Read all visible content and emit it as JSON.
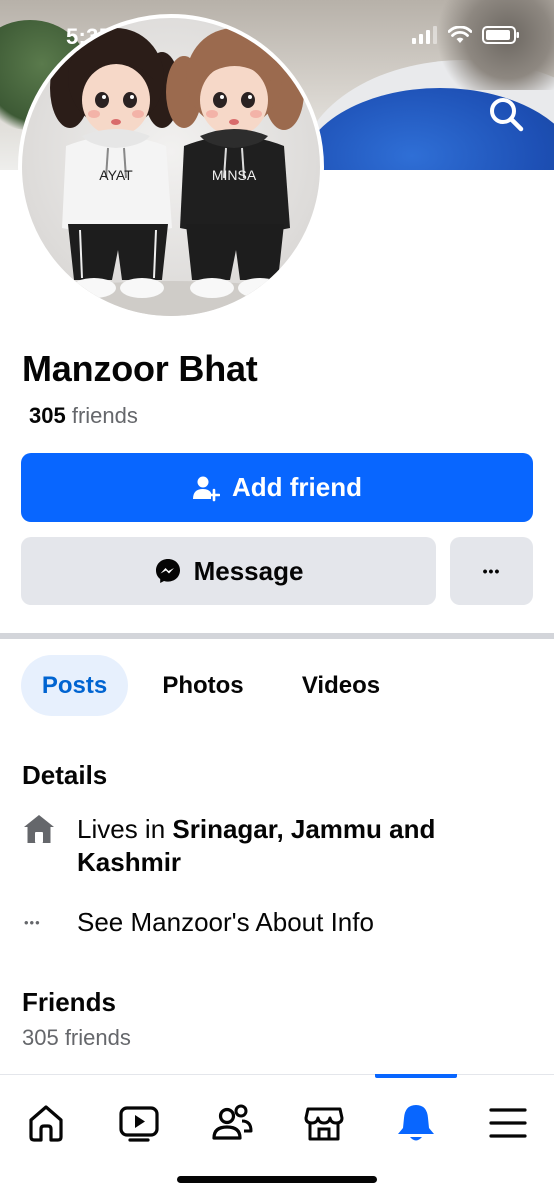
{
  "status_bar": {
    "time": "5:35"
  },
  "header": {
    "back_icon": "chevron-left-icon",
    "search_icon": "search-icon"
  },
  "avatar": {
    "left_hoodie_text": "AYAT",
    "right_hoodie_text": "MINSA"
  },
  "profile": {
    "name": "Manzoor Bhat",
    "friends_count": "305",
    "friends_word": "friends"
  },
  "actions": {
    "add_friend_label": "Add friend",
    "message_label": "Message",
    "more_label": "•••"
  },
  "tabs": [
    {
      "label": "Posts",
      "active": true
    },
    {
      "label": "Photos",
      "active": false
    },
    {
      "label": "Videos",
      "active": false
    }
  ],
  "details": {
    "title": "Details",
    "lives_prefix": "Lives in ",
    "lives_place": "Srinagar, Jammu and Kashmir",
    "about_dots": "•••",
    "about_label": "See Manzoor's About Info"
  },
  "friends_section": {
    "title": "Friends",
    "count_text": "305 friends"
  },
  "bottom_nav": {
    "items": [
      {
        "icon": "home-icon"
      },
      {
        "icon": "video-icon"
      },
      {
        "icon": "friends-icon"
      },
      {
        "icon": "marketplace-icon"
      },
      {
        "icon": "bell-icon",
        "active": true
      },
      {
        "icon": "menu-icon"
      }
    ]
  },
  "colors": {
    "accent": "#0866ff",
    "tab_active_bg": "#e7f0fd",
    "tab_active_text": "#0064d1",
    "secondary_button": "#e4e6eb",
    "muted_text": "#65676b"
  }
}
